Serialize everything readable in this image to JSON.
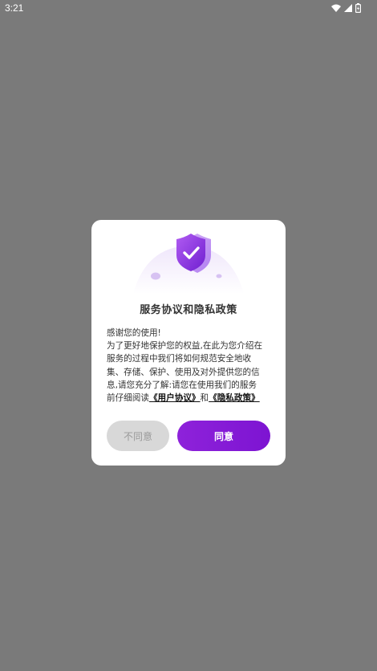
{
  "status_bar": {
    "time": "3:21",
    "icons": [
      "wifi-icon",
      "signal-icon",
      "battery-icon"
    ]
  },
  "dialog": {
    "title": "服务协议和隐私政策",
    "body_lines": [
      "感谢您的使用!",
      "为了更好地保护您的权益,在此为您介绍在",
      "服务的过程中我们将如何规范安全地收",
      "集、存储、保护、使用及对外提供您的信",
      "息,请您充分了解:请您在使用我们的服务"
    ],
    "last_line_prefix": "前仔细阅读",
    "user_agreement_link": "《用户协议》",
    "conjunction": "和",
    "privacy_policy_link": "《隐私政策》",
    "disagree_label": "不同意",
    "agree_label": "同意",
    "icon": "shield-check-icon"
  },
  "colors": {
    "backdrop": "#7a7a7a",
    "accent": "#8b1fd8",
    "disagree_bg": "#d8d8d8"
  }
}
